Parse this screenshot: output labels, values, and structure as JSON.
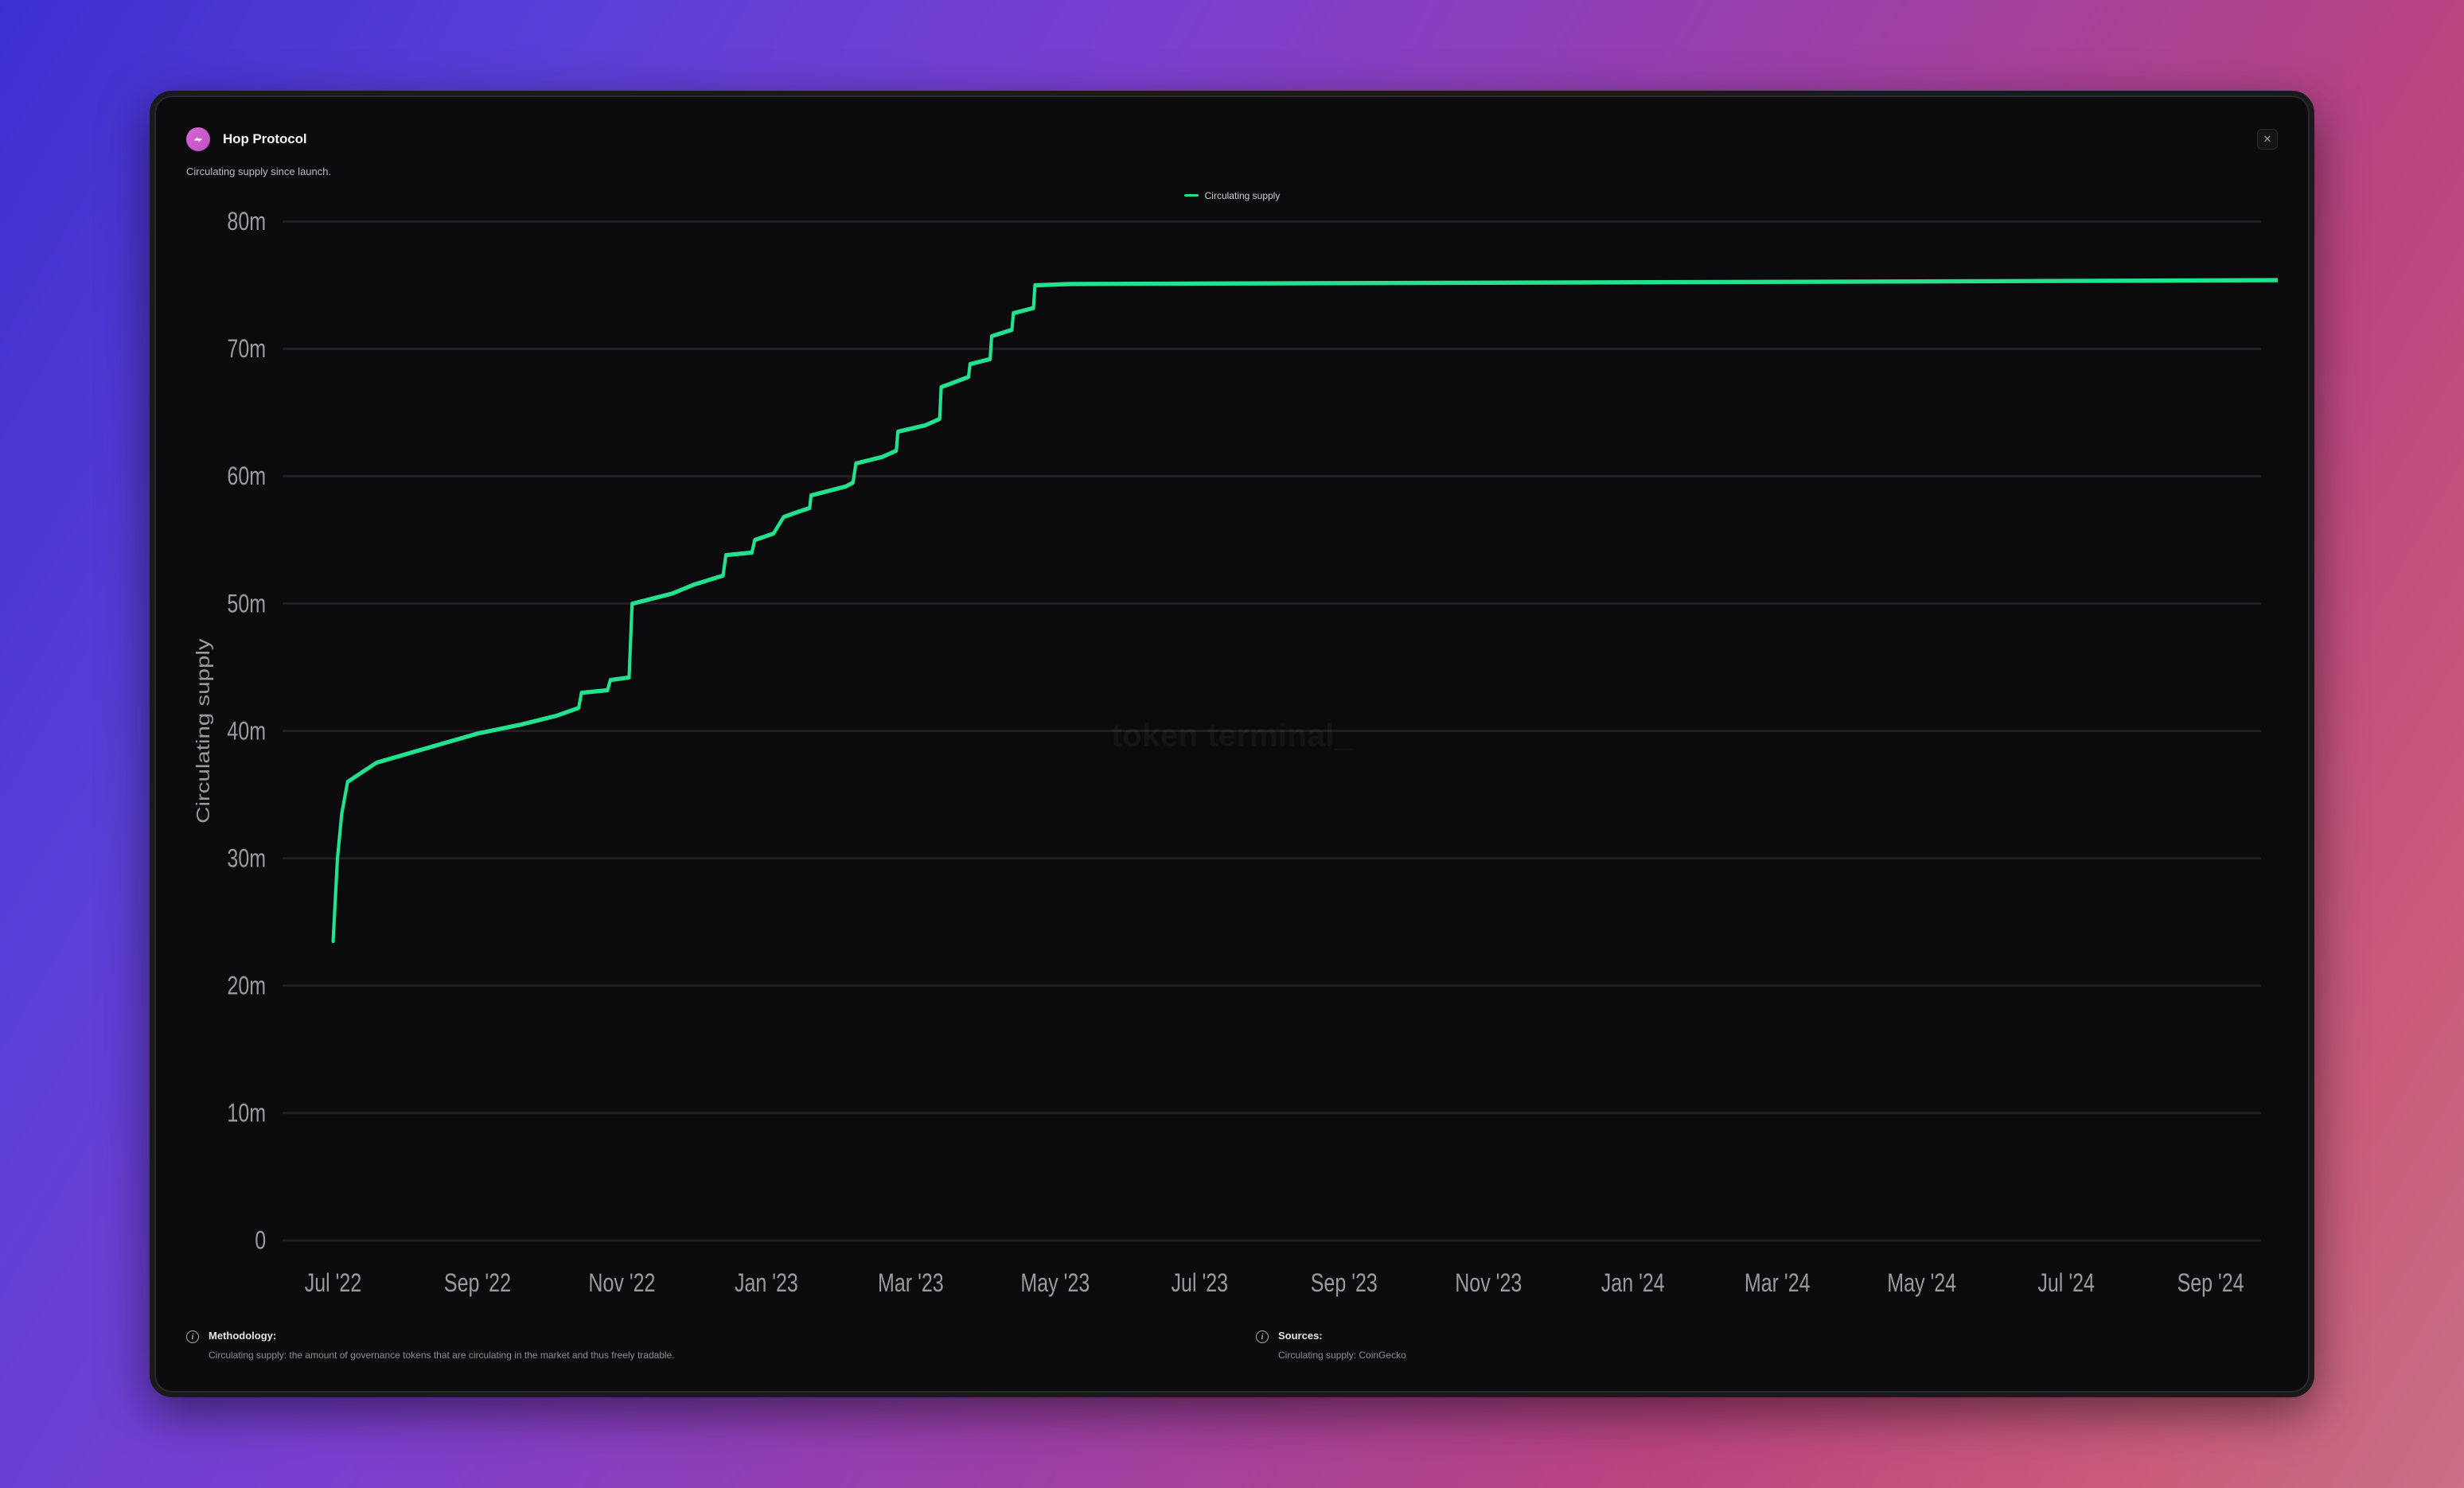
{
  "header": {
    "title": "Hop Protocol",
    "logo_name": "hop-logo"
  },
  "subtitle": "Circulating supply since launch.",
  "legend": {
    "series_label": "Circulating supply",
    "series_color": "#23e28e"
  },
  "watermark": "token terminal_",
  "footer": {
    "methodology_title": "Methodology:",
    "methodology_text": "Circulating supply: the amount of governance tokens that are circulating in the market and thus freely tradable.",
    "sources_title": "Sources:",
    "sources_text": "Circulating supply: CoinGecko"
  },
  "chart_data": {
    "type": "line",
    "title": "Hop Protocol — Circulating supply since launch",
    "xlabel": "",
    "ylabel": "Circulating supply",
    "ylim": [
      0,
      80000000
    ],
    "y_ticks": [
      0,
      10000000,
      20000000,
      30000000,
      40000000,
      50000000,
      60000000,
      70000000,
      80000000
    ],
    "y_tick_labels": [
      "0",
      "10m",
      "20m",
      "30m",
      "40m",
      "50m",
      "60m",
      "70m",
      "80m"
    ],
    "x_categories": [
      "Jul '22",
      "Sep '22",
      "Nov '22",
      "Jan '23",
      "Mar '23",
      "May '23",
      "Jul '23",
      "Sep '23",
      "Nov '23",
      "Jan '24",
      "Mar '24",
      "May '24",
      "Jul '24",
      "Sep '24"
    ],
    "series": [
      {
        "name": "Circulating supply",
        "color": "#23e28e",
        "points": [
          {
            "x": 0.0,
            "y": 23500000
          },
          {
            "x": 0.03,
            "y": 30000000
          },
          {
            "x": 0.06,
            "y": 33500000
          },
          {
            "x": 0.1,
            "y": 36000000
          },
          {
            "x": 0.3,
            "y": 37500000
          },
          {
            "x": 0.6,
            "y": 38500000
          },
          {
            "x": 1.0,
            "y": 39800000
          },
          {
            "x": 1.3,
            "y": 40500000
          },
          {
            "x": 1.55,
            "y": 41200000
          },
          {
            "x": 1.7,
            "y": 41800000
          },
          {
            "x": 1.72,
            "y": 43000000
          },
          {
            "x": 1.9,
            "y": 43200000
          },
          {
            "x": 1.92,
            "y": 44000000
          },
          {
            "x": 2.05,
            "y": 44200000
          },
          {
            "x": 2.07,
            "y": 50000000
          },
          {
            "x": 2.35,
            "y": 50800000
          },
          {
            "x": 2.5,
            "y": 51500000
          },
          {
            "x": 2.7,
            "y": 52200000
          },
          {
            "x": 2.72,
            "y": 53800000
          },
          {
            "x": 2.9,
            "y": 54000000
          },
          {
            "x": 2.92,
            "y": 55000000
          },
          {
            "x": 3.05,
            "y": 55500000
          },
          {
            "x": 3.12,
            "y": 56800000
          },
          {
            "x": 3.22,
            "y": 57200000
          },
          {
            "x": 3.3,
            "y": 57500000
          },
          {
            "x": 3.31,
            "y": 58500000
          },
          {
            "x": 3.55,
            "y": 59200000
          },
          {
            "x": 3.6,
            "y": 59500000
          },
          {
            "x": 3.62,
            "y": 61000000
          },
          {
            "x": 3.8,
            "y": 61500000
          },
          {
            "x": 3.9,
            "y": 62000000
          },
          {
            "x": 3.91,
            "y": 63500000
          },
          {
            "x": 4.1,
            "y": 64000000
          },
          {
            "x": 4.2,
            "y": 64500000
          },
          {
            "x": 4.21,
            "y": 67000000
          },
          {
            "x": 4.4,
            "y": 67800000
          },
          {
            "x": 4.41,
            "y": 68800000
          },
          {
            "x": 4.55,
            "y": 69200000
          },
          {
            "x": 4.56,
            "y": 71000000
          },
          {
            "x": 4.7,
            "y": 71500000
          },
          {
            "x": 4.71,
            "y": 72800000
          },
          {
            "x": 4.85,
            "y": 73200000
          },
          {
            "x": 4.86,
            "y": 75000000
          },
          {
            "x": 5.1,
            "y": 75100000
          },
          {
            "x": 8.0,
            "y": 75200000
          },
          {
            "x": 11.0,
            "y": 75300000
          },
          {
            "x": 13.5,
            "y": 75400000
          }
        ]
      }
    ]
  }
}
